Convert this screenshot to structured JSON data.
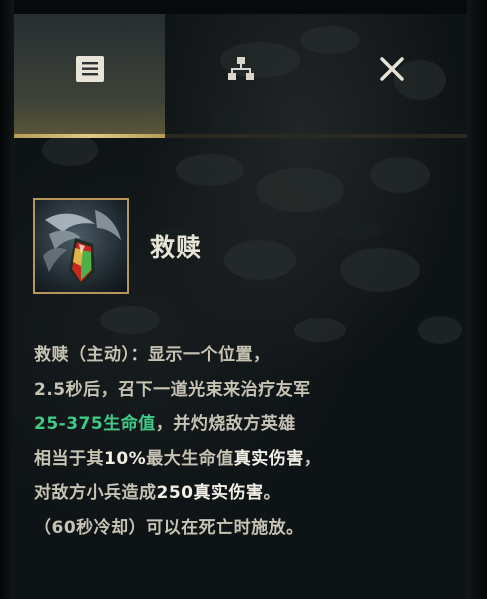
{
  "tabs": [
    {
      "id": "description",
      "icon": "description-icon",
      "active": true
    },
    {
      "id": "tree",
      "icon": "hierarchy-icon",
      "active": false
    },
    {
      "id": "close",
      "icon": "close-icon",
      "active": false
    }
  ],
  "ability": {
    "name": "救赎",
    "icon": "redemption-ability-icon"
  },
  "description": {
    "line1": "救赎（主动）：显示一个位置，",
    "line2": "2.5秒后，召下一道光束来治疗友军",
    "line3_highlight": "25-375生命值",
    "line3_rest": "，并灼烧敌方英雄",
    "line4_a": "相当于其",
    "line4_b": "10%",
    "line4_c": "最大生命值",
    "line4_d": "真实伤害",
    "line4_e": "，",
    "line5_a": "对敌方小兵造成",
    "line5_b": "250",
    "line5_c": "真实伤害",
    "line5_d": "。",
    "line6": "（60秒冷却）可以在死亡时施放。"
  },
  "colors": {
    "accent_gold": "#d8bd7c",
    "heal_green": "#3fca86",
    "text": "#c6c2b4"
  }
}
